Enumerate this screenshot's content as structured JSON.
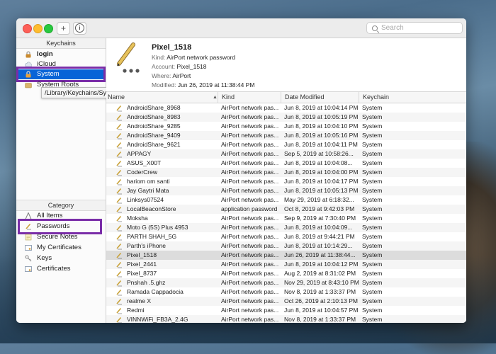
{
  "toolbar": {
    "search_placeholder": "Search",
    "add_label": "+",
    "info_label": "i"
  },
  "sidebar": {
    "keychains_header": "Keychains",
    "keychains": [
      {
        "label": "login",
        "icon": "lock-icon",
        "bold": true
      },
      {
        "label": "iCloud",
        "icon": "cloud-icon"
      },
      {
        "label": "System",
        "icon": "lock-icon",
        "selected": true
      },
      {
        "label": "System Roots",
        "icon": "folder-icon"
      }
    ],
    "tooltip": "/Library/Keychains/System.keychain",
    "category_header": "Category",
    "categories": [
      {
        "label": "All Items",
        "icon": "all-items-icon"
      },
      {
        "label": "Passwords",
        "icon": "password-icon"
      },
      {
        "label": "Secure Notes",
        "icon": "note-icon"
      },
      {
        "label": "My Certificates",
        "icon": "certificate-icon"
      },
      {
        "label": "Keys",
        "icon": "key-icon"
      },
      {
        "label": "Certificates",
        "icon": "certificate-icon"
      }
    ]
  },
  "detail": {
    "title": "Pixel_1518",
    "rows": [
      {
        "key": "Kind:",
        "value": "AirPort network password"
      },
      {
        "key": "Account:",
        "value": "Pixel_1518"
      },
      {
        "key": "Where:",
        "value": "AirPort"
      },
      {
        "key": "Modified:",
        "value": "Jun 26, 2019 at 11:38:44 PM"
      }
    ]
  },
  "table": {
    "columns": [
      "Name",
      "Kind",
      "Date Modified",
      "Keychain"
    ],
    "rows": [
      [
        "AndroidShare_8968",
        "AirPort network pas...",
        "Jun 8, 2019 at 10:04:14 PM",
        "System"
      ],
      [
        "AndroidShare_8983",
        "AirPort network pas...",
        "Jun 8, 2019 at 10:05:19 PM",
        "System"
      ],
      [
        "AndroidShare_9285",
        "AirPort network pas...",
        "Jun 8, 2019 at 10:04:10 PM",
        "System"
      ],
      [
        "AndroidShare_9409",
        "AirPort network pas...",
        "Jun 8, 2019 at 10:05:16 PM",
        "System"
      ],
      [
        "AndroidShare_9621",
        "AirPort network pas...",
        "Jun 8, 2019 at 10:04:11 PM",
        "System"
      ],
      [
        "APPAGY",
        "AirPort network pas...",
        "Sep 5, 2019 at 10:58:26...",
        "System"
      ],
      [
        "ASUS_X00T",
        "AirPort network pas...",
        "Jun 8, 2019 at 10:04:08...",
        "System"
      ],
      [
        "CoderCrew",
        "AirPort network pas...",
        "Jun 8, 2019 at 10:04:00 PM",
        "System"
      ],
      [
        "hariom om santi",
        "AirPort network pas...",
        "Jun 8, 2019 at 10:04:17 PM",
        "System"
      ],
      [
        "Jay Gaytri Mata",
        "AirPort network pas...",
        "Jun 8, 2019 at 10:05:13 PM",
        "System"
      ],
      [
        "Linksys07524",
        "AirPort network pas...",
        "May 29, 2019 at 6:18:32...",
        "System"
      ],
      [
        "LocalBeaconStore",
        "application password",
        "Oct 8, 2019 at 9:42:03 PM",
        "System"
      ],
      [
        "Moksha",
        "AirPort network pas...",
        "Sep 9, 2019 at 7:30:40 PM",
        "System"
      ],
      [
        "Moto G (5S) Plus 4953",
        "AirPort network pas...",
        "Jun 8, 2019 at 10:04:09...",
        "System"
      ],
      [
        "PARTH SHAH_5G",
        "AirPort network pas...",
        "Jun 8, 2019 at 9:44:21 PM",
        "System"
      ],
      [
        "Parth's iPhone",
        "AirPort network pas...",
        "Jun 8, 2019 at 10:14:29...",
        "System"
      ],
      [
        "Pixel_1518",
        "AirPort network pas...",
        "Jun 26, 2019 at 11:38:44...",
        "System"
      ],
      [
        "Pixel_2441",
        "AirPort network pas...",
        "Jun 8, 2019 at 10:04:12 PM",
        "System"
      ],
      [
        "Pixel_8737",
        "AirPort network pas...",
        "Aug 2, 2019 at 8:31:02 PM",
        "System"
      ],
      [
        "Pnshah .5.ghz",
        "AirPort network pas...",
        "Nov 29, 2019 at 8:43:10 PM",
        "System"
      ],
      [
        "Ramada Cappadocia",
        "AirPort network pas...",
        "Nov 8, 2019 at 1:33:37 PM",
        "System"
      ],
      [
        "realme X",
        "AirPort network pas...",
        "Oct 26, 2019 at 2:10:13 PM",
        "System"
      ],
      [
        "Redmi",
        "AirPort network pas...",
        "Jun 8, 2019 at 10:04:57 PM",
        "System"
      ],
      [
        "VINNWiFi_FB3A_2.4G",
        "AirPort network pas...",
        "Nov 8, 2019 at 1:33:37 PM",
        "System"
      ]
    ],
    "selected_index": 16
  }
}
